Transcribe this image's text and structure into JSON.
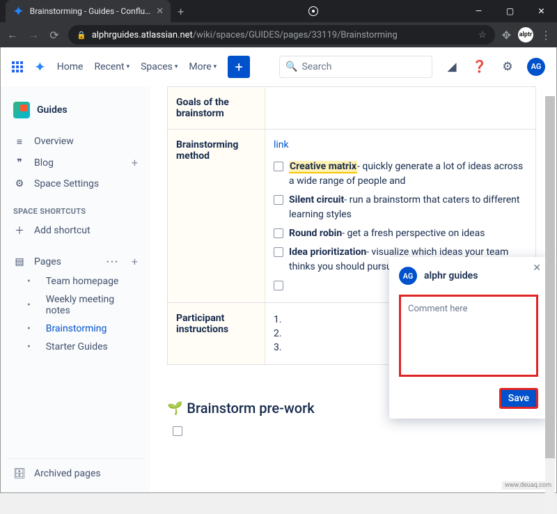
{
  "browser": {
    "tab_title": "Brainstorming - Guides - Conflu…",
    "url_host": "alphrguides.atlassian.net",
    "url_path": "/wiki/spaces/GUIDES/pages/33119/Brainstorming",
    "avatar": "alptr"
  },
  "topnav": {
    "home": "Home",
    "recent": "Recent",
    "spaces": "Spaces",
    "more": "More",
    "search_placeholder": "Search",
    "avatar": "AG"
  },
  "sidebar": {
    "space": "Guides",
    "overview": "Overview",
    "blog": "Blog",
    "space_settings": "Space Settings",
    "shortcuts_label": "SPACE SHORTCUTS",
    "add_shortcut": "Add shortcut",
    "pages": "Pages",
    "tree": [
      "Team homepage",
      "Weekly meeting notes",
      "Brainstorming",
      "Starter Guides"
    ],
    "archived": "Archived pages"
  },
  "table": {
    "r1_label": "Goals of the brainstorm",
    "r2_label": "Brainstorming method",
    "r2_link": "link",
    "items": [
      {
        "title": "Creative matrix",
        "rest": "- quickly generate a lot of ideas across a wide range of people and"
      },
      {
        "title": "Silent circuit",
        "rest": "- run a brainstorm that caters to different learning styles"
      },
      {
        "title": "Round robin",
        "rest": "- get a fresh perspective on ideas"
      },
      {
        "title": "Idea prioritization",
        "rest": "- visualize which ideas your team thinks you should pursue first"
      }
    ],
    "r3_label": "Participant instructions"
  },
  "section2": "Brainstorm pre-work",
  "comment": {
    "user": "alphr guides",
    "avatar": "AG",
    "placeholder": "Comment here",
    "save": "Save"
  },
  "watermark": "www.deuaq.com"
}
